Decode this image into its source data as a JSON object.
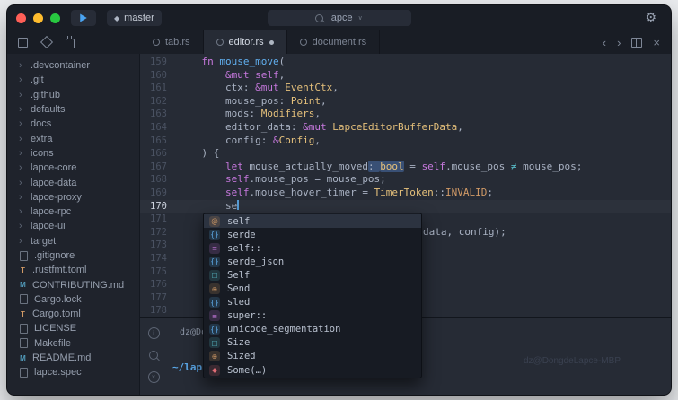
{
  "colors": {
    "fg": "#a9b2c3",
    "kw": "#c678dd",
    "fn": "#61afef",
    "type": "#e5c07b",
    "const": "#d19a66",
    "op": "#56b6c2"
  },
  "icons": {
    "gear": "⚙",
    "chev_left": "‹",
    "chev_right": "›",
    "close": "×",
    "diamond": "◆",
    "dropdown": "∨",
    "tree_chev": "›",
    "info": "i",
    "term_close": "×"
  },
  "titlebar": {
    "branch": "master",
    "search_value": "lapce"
  },
  "tabbar": {
    "tabs": [
      {
        "label": "tab.rs",
        "active": false,
        "modified": false
      },
      {
        "label": "editor.rs",
        "active": true,
        "modified": true
      },
      {
        "label": "document.rs",
        "active": false,
        "modified": false
      }
    ]
  },
  "sidebar": {
    "items": [
      {
        "label": ".devcontainer",
        "type": "folder"
      },
      {
        "label": ".git",
        "type": "folder"
      },
      {
        "label": ".github",
        "type": "folder"
      },
      {
        "label": "defaults",
        "type": "folder"
      },
      {
        "label": "docs",
        "type": "folder"
      },
      {
        "label": "extra",
        "type": "folder"
      },
      {
        "label": "icons",
        "type": "folder"
      },
      {
        "label": "lapce-core",
        "type": "folder"
      },
      {
        "label": "lapce-data",
        "type": "folder"
      },
      {
        "label": "lapce-proxy",
        "type": "folder"
      },
      {
        "label": "lapce-rpc",
        "type": "folder"
      },
      {
        "label": "lapce-ui",
        "type": "folder"
      },
      {
        "label": "target",
        "type": "folder"
      },
      {
        "label": ".gitignore",
        "type": "file",
        "icon": "doc"
      },
      {
        "label": ".rustfmt.toml",
        "type": "file",
        "icon": "toml"
      },
      {
        "label": "CONTRIBUTING.md",
        "type": "file",
        "icon": "md"
      },
      {
        "label": "Cargo.lock",
        "type": "file",
        "icon": "doc"
      },
      {
        "label": "Cargo.toml",
        "type": "file",
        "icon": "toml"
      },
      {
        "label": "LICENSE",
        "type": "file",
        "icon": "doc"
      },
      {
        "label": "Makefile",
        "type": "file",
        "icon": "doc"
      },
      {
        "label": "README.md",
        "type": "file",
        "icon": "md"
      },
      {
        "label": "lapce.spec",
        "type": "file",
        "icon": "doc"
      }
    ]
  },
  "editor": {
    "lines": [
      {
        "n": 159,
        "ind": 1,
        "s": [
          {
            "t": "fn ",
            "c": "kw"
          },
          {
            "t": "mouse_move",
            "c": "fn"
          },
          {
            "t": "(",
            "c": "fg"
          }
        ]
      },
      {
        "n": 160,
        "ind": 2,
        "s": [
          {
            "t": "&mut ",
            "c": "kw"
          },
          {
            "t": "self",
            "c": "kw"
          },
          {
            "t": ",",
            "c": "fg"
          }
        ]
      },
      {
        "n": 161,
        "ind": 2,
        "s": [
          {
            "t": "ctx: ",
            "c": "fg"
          },
          {
            "t": "&mut ",
            "c": "kw"
          },
          {
            "t": "EventCtx",
            "c": "type"
          },
          {
            "t": ",",
            "c": "fg"
          }
        ]
      },
      {
        "n": 162,
        "ind": 2,
        "s": [
          {
            "t": "mouse_pos: ",
            "c": "fg"
          },
          {
            "t": "Point",
            "c": "type"
          },
          {
            "t": ",",
            "c": "fg"
          }
        ]
      },
      {
        "n": 163,
        "ind": 2,
        "s": [
          {
            "t": "mods: ",
            "c": "fg"
          },
          {
            "t": "Modifiers",
            "c": "type"
          },
          {
            "t": ",",
            "c": "fg"
          }
        ]
      },
      {
        "n": 164,
        "ind": 2,
        "s": [
          {
            "t": "editor_data: ",
            "c": "fg"
          },
          {
            "t": "&mut ",
            "c": "kw"
          },
          {
            "t": "LapceEditorBufferData",
            "c": "type"
          },
          {
            "t": ",",
            "c": "fg"
          }
        ]
      },
      {
        "n": 165,
        "ind": 2,
        "s": [
          {
            "t": "config: ",
            "c": "fg"
          },
          {
            "t": "&",
            "c": "kw"
          },
          {
            "t": "Config",
            "c": "type"
          },
          {
            "t": ",",
            "c": "fg"
          }
        ]
      },
      {
        "n": 166,
        "ind": 1,
        "s": [
          {
            "t": ") {",
            "c": "fg"
          }
        ]
      },
      {
        "n": 167,
        "ind": 2,
        "s": [
          {
            "t": "let ",
            "c": "kw"
          },
          {
            "t": "mouse_actually_moved",
            "c": "fg"
          },
          {
            "t": ": ",
            "c": "fg",
            "h": true
          },
          {
            "t": "bool",
            "c": "type",
            "h": true
          },
          {
            "t": " = ",
            "c": "fg"
          },
          {
            "t": "self",
            "c": "kw"
          },
          {
            "t": ".mouse_pos ",
            "c": "fg"
          },
          {
            "t": "≠",
            "c": "op"
          },
          {
            "t": " mouse_pos;",
            "c": "fg"
          }
        ]
      },
      {
        "n": 168,
        "ind": 2,
        "s": [
          {
            "t": "self",
            "c": "kw"
          },
          {
            "t": ".mouse_pos = mouse_pos;",
            "c": "fg"
          }
        ]
      },
      {
        "n": 169,
        "ind": 2,
        "s": [
          {
            "t": "self",
            "c": "kw"
          },
          {
            "t": ".mouse_hover_timer = ",
            "c": "fg"
          },
          {
            "t": "TimerToken",
            "c": "type"
          },
          {
            "t": "::",
            "c": "fg"
          },
          {
            "t": "INVALID",
            "c": "const"
          },
          {
            "t": ";",
            "c": "fg"
          }
        ]
      },
      {
        "n": 170,
        "ind": 2,
        "cur": true,
        "s": [
          {
            "t": "se",
            "c": "fg"
          },
          {
            "caret": true
          }
        ]
      },
      {
        "n": 171,
        "ind": 0,
        "s": []
      },
      {
        "n": 172,
        "ind": 0,
        "s": [
          {
            "t": "data, config);",
            "c": "fg",
            "ml": 273
          }
        ]
      },
      {
        "n": 173,
        "ind": 0,
        "s": []
      },
      {
        "n": 174,
        "ind": 0,
        "s": []
      },
      {
        "n": 175,
        "ind": 0,
        "s": []
      },
      {
        "n": 176,
        "ind": 0,
        "s": []
      },
      {
        "n": 177,
        "ind": 0,
        "s": []
      },
      {
        "n": 178,
        "ind": 0,
        "s": []
      }
    ]
  },
  "popup": {
    "selected": 0,
    "kinds": {
      "variable": {
        "glyph": "@",
        "fg": "#d19a66",
        "bg": "rgba(209,154,102,.18)"
      },
      "module": {
        "glyph": "{}",
        "fg": "#61afef",
        "bg": "rgba(97,175,239,.18)"
      },
      "keyword": {
        "glyph": "≡",
        "fg": "#c678dd",
        "bg": "rgba(198,120,221,.18)"
      },
      "struct": {
        "glyph": "□",
        "fg": "#56b6c2",
        "bg": "rgba(86,182,194,.18)"
      },
      "trait": {
        "glyph": "⊕",
        "fg": "#d19a66",
        "bg": "rgba(209,154,102,.18)"
      },
      "enum-member": {
        "glyph": "◆",
        "fg": "#e06c75",
        "bg": "rgba(224,108,117,.18)"
      }
    },
    "items": [
      {
        "label": "self",
        "kind": "variable"
      },
      {
        "label": "serde",
        "kind": "module"
      },
      {
        "label": "self::",
        "kind": "keyword"
      },
      {
        "label": "serde_json",
        "kind": "module"
      },
      {
        "label": "Self",
        "kind": "struct"
      },
      {
        "label": "Send",
        "kind": "trait"
      },
      {
        "label": "sled",
        "kind": "module"
      },
      {
        "label": "super::",
        "kind": "keyword"
      },
      {
        "label": "unicode_segmentation",
        "kind": "module"
      },
      {
        "label": "Size",
        "kind": "struct"
      },
      {
        "label": "Sized",
        "kind": "trait"
      },
      {
        "label": "Some(…)",
        "kind": "enum-member"
      }
    ]
  },
  "terminal": {
    "tab_label": "dz@DongdeLapce-MBP",
    "prompt_path": "~/lapce",
    "watermark": "dz@DongdeLapce-MBP"
  },
  "traffic_lights": {
    "close": "#ff5f57",
    "minimize": "#febc2e",
    "zoom": "#28c840"
  }
}
